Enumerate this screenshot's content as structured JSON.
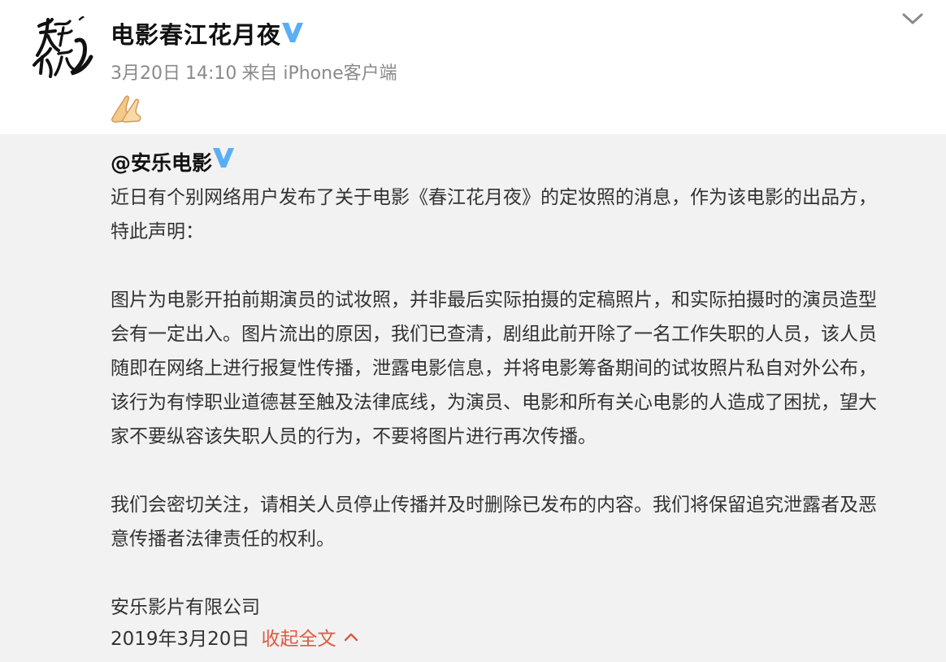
{
  "post": {
    "author_name": "电影春江花月夜",
    "date": "3月20日",
    "time": "14:10",
    "source": "来自 iPhone客户端",
    "avatar_text": "春江花月夜",
    "emoji": "praying-hands-emoji",
    "menu_icon": "chevron-down-icon"
  },
  "repost": {
    "author": "@安乐电影",
    "lines": [
      "近日有个别网络用户发布了关于电影《春江花月夜》的定妆照的消息，作为该电影的出品方，",
      "特此声明：",
      "",
      "图片为电影开拍前期演员的试妆照，并非最后实际拍摄的定稿照片，和实际拍摄时的演员造型",
      "会有一定出入。图片流出的原因，我们已查清，剧组此前开除了一名工作失职的人员，该人员",
      "随即在网络上进行报复性传播，泄露电影信息，并将电影筹备期间的试妆照片私自对外公布，",
      "该行为有悖职业道德甚至触及法律底线，为演员、电影和所有关心电影的人造成了困扰，望大",
      "家不要纵容该失职人员的行为，不要将图片进行再次传播。",
      "",
      "我们会密切关注，请相关人员停止传播并及时删除已发布的内容。我们将保留追究泄露者及恶",
      "意传播者法律责任的权利。",
      "",
      "安乐影片有限公司"
    ],
    "date": "2019年3月20日",
    "collapse_label": "收起全文"
  },
  "colors": {
    "verify_blue": "#5aaef5",
    "link_red": "#e2583e",
    "repost_bg": "#f2f2f2",
    "meta_gray": "#8a8a8a"
  }
}
